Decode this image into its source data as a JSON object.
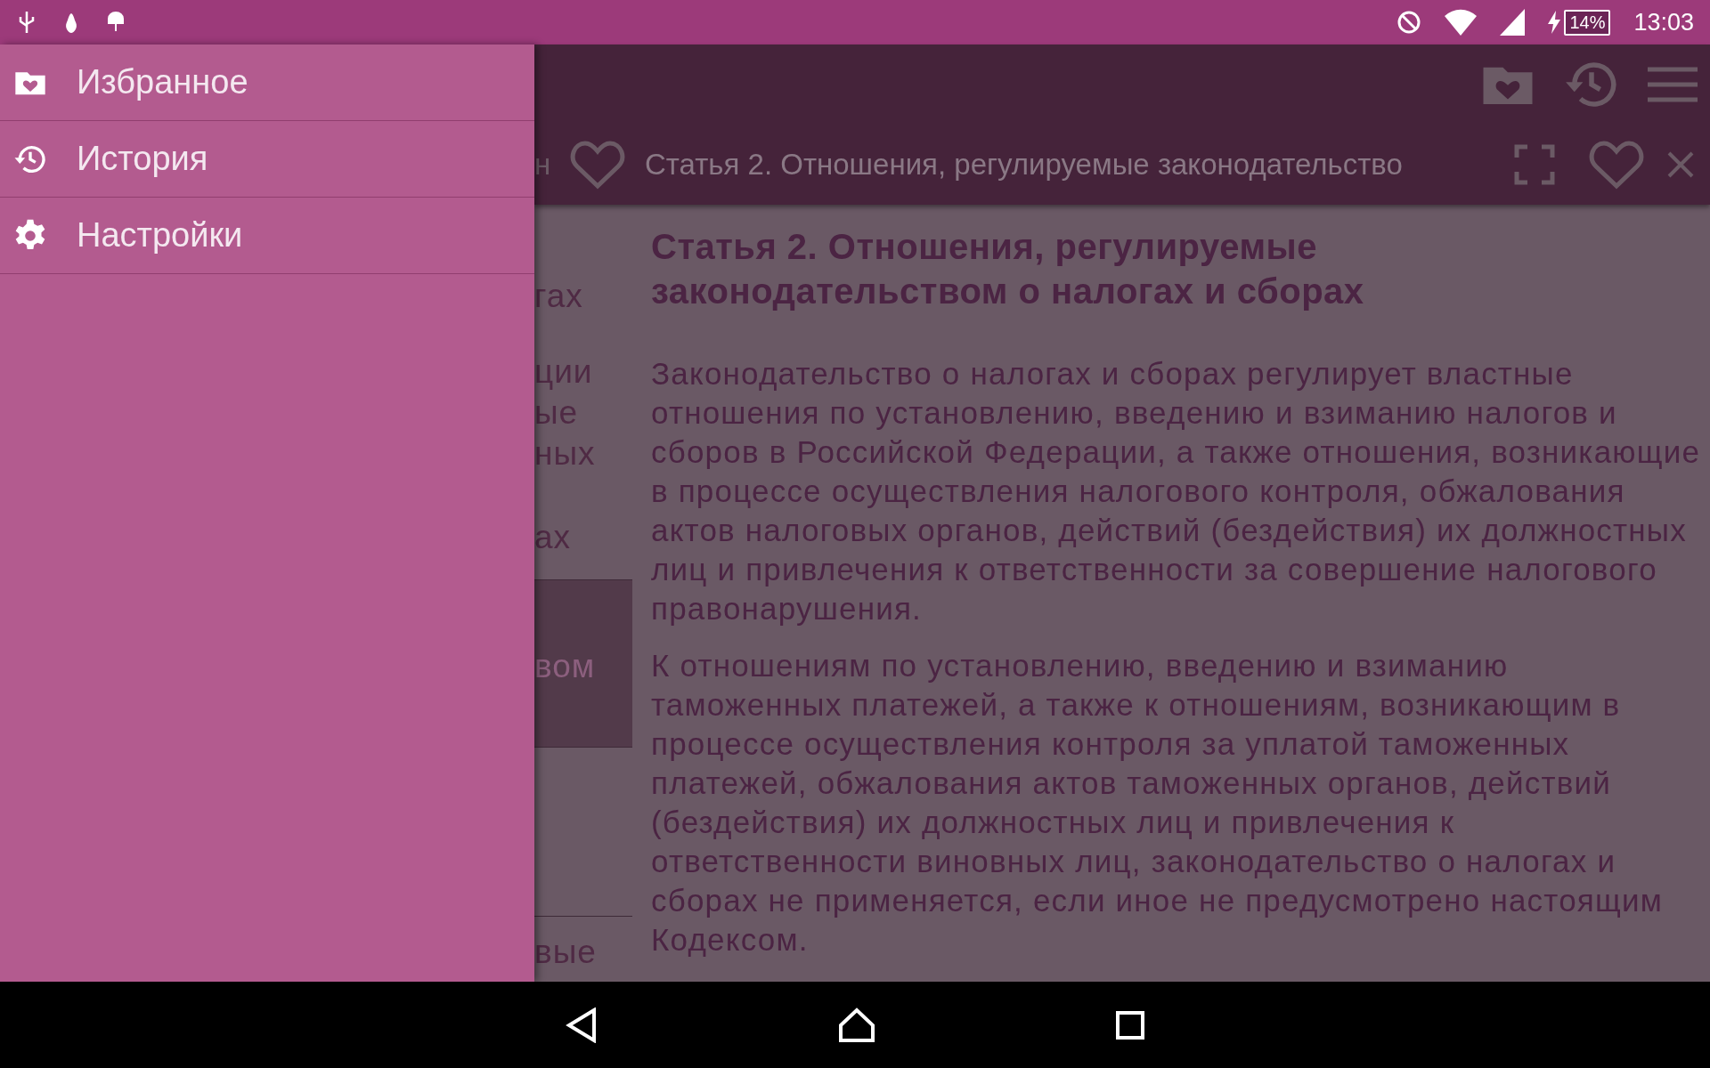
{
  "status_bar": {
    "battery": "14%",
    "time": "13:03"
  },
  "drawer": {
    "items": [
      {
        "label": "Избранное"
      },
      {
        "label": "История"
      },
      {
        "label": "Настройки"
      }
    ]
  },
  "tab_bar": {
    "tab_fragment": "н",
    "open_tab_title": "Статья 2. Отношения, регулируемые законодательство"
  },
  "contents_list": {
    "items": [
      {
        "lines": [
          "гах"
        ],
        "selected": false
      },
      {
        "lines": [
          "ции",
          "ые",
          "ных"
        ],
        "selected": false
      },
      {
        "lines": [
          "ах"
        ],
        "selected": false
      },
      {
        "lines": [
          "вом"
        ],
        "selected": true
      },
      {
        "lines": [
          "вые"
        ],
        "selected": false
      }
    ]
  },
  "article": {
    "title": "Статья 2. Отношения, регулируемые законодательством о налогах и сборах",
    "paragraphs": [
      "Законодательство о налогах и сборах регулирует властные отношения по установлению, введению и взиманию налогов и сборов в Российской Федерации, а также отношения, возникающие в процессе осуществления налогового контроля, обжалования актов налоговых органов, действий (бездействия) их должностных лиц и привлечения к ответственности за совершение налогового правонарушения.",
      "К отношениям по установлению, введению и взиманию таможенных платежей, а также к отношениям, возникающим в процессе осуществления контроля за уплатой таможенных платежей, обжалования актов таможенных органов, действий (бездействия) их должностных лиц и привлечения к ответственности виновных лиц, законодательство о налогах и сборах не применяется, если иное не предусмотрено настоящим Кодексом."
    ]
  }
}
